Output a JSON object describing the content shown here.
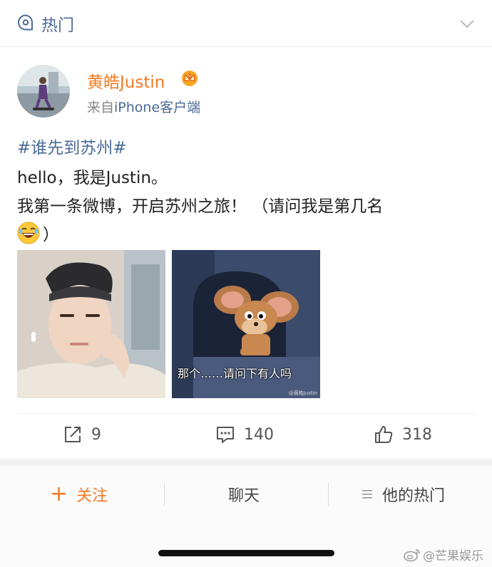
{
  "header": {
    "title": "热门"
  },
  "post": {
    "username": "黄皓Justin",
    "source_prefix": "来自",
    "source_link": "iPhone客户端",
    "hashtag": "#谁先到苏州#",
    "line1": "hello，我是Justin。",
    "line2": "我第一条微博，开启苏州之旅！ （请问我是第几名",
    "line3_tail": "）",
    "emoji": "laugh-emoji",
    "images": [
      {
        "name": "selfie-photo"
      },
      {
        "name": "jerry-meme",
        "caption": "那个……请问下有人吗",
        "watermark": "@黄皓Justin"
      }
    ]
  },
  "actions": {
    "repost_count": "9",
    "comment_count": "140",
    "like_count": "318"
  },
  "bottom_bar": {
    "follow_icon": "+",
    "follow_label": "关注",
    "chat_label": "聊天",
    "hot_label": "他的热门"
  },
  "watermark": {
    "text": "@芒果娱乐"
  },
  "colors": {
    "accent_orange": "#f27a22",
    "link_blue": "#4b6a97",
    "text": "#222222"
  }
}
